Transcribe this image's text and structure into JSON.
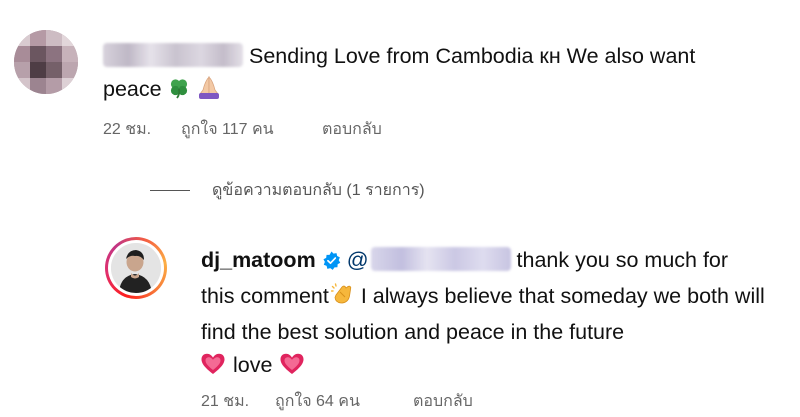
{
  "comment": {
    "text_line": "Sending Love from Cambodia кн We also want",
    "text_word": "peace",
    "emojis": [
      "four-leaf-clover",
      "folded-hands"
    ],
    "time": "22 ชม.",
    "likes": "ถูกใจ 117 คน",
    "reply_label": "ตอบกลับ"
  },
  "replies_toggle": {
    "label": "ดูข้อความตอบกลับ (1 รายการ)"
  },
  "reply": {
    "username": "dj_matoom",
    "verified": true,
    "mention_prefix": "@",
    "text_1": "thank you so much for",
    "text_2": "this comment",
    "text_3": "I always believe that someday we both will find the best solution and peace in the future",
    "text_4": "love",
    "emojis": [
      "clapping-hands",
      "growing-heart",
      "growing-heart"
    ],
    "time": "21 ชม.",
    "likes": "ถูกใจ 64 คน",
    "reply_label": "ตอบกลับ"
  },
  "colors": {
    "text": "#111111",
    "meta": "#666666",
    "mention": "#00376b",
    "verified": "#0095f6",
    "heart": "#e0245e"
  }
}
